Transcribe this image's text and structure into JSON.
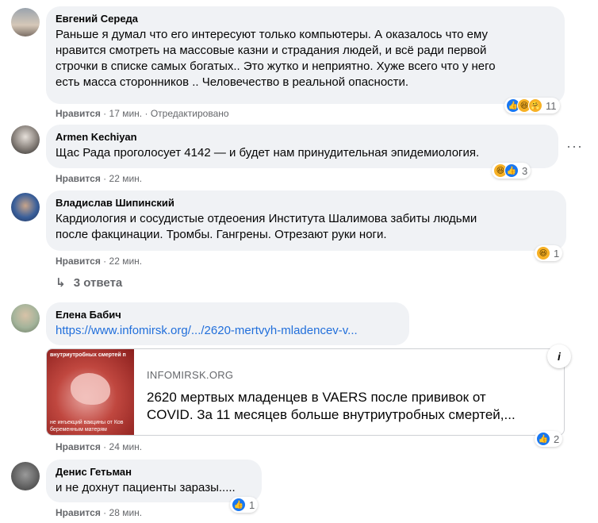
{
  "comments": [
    {
      "author": "Евгений Середа",
      "lines": [
        "Раньше я думал что его интересуют только компьютеры. А оказалось что ему",
        "нравится смотреть на массовые казни и страдания людей, и всё ради первой",
        "строчки в списке самых богатых.. Это жутко и неприятно. Хуже всего что у него",
        "есть масса сторонников .. Человечество в реальной опасности."
      ],
      "like_label": "Нравится",
      "time": "17 мин.",
      "edited": "Отредактировано",
      "reactions": [
        "like-icon",
        "haha-icon",
        "care-icon"
      ],
      "reaction_count": "11"
    },
    {
      "author": "Armen Kechiyan",
      "lines": [
        "Щас Рада проголосует 4142 — и будет нам принудительная эпидемиология."
      ],
      "like_label": "Нравится",
      "time": "22 мин.",
      "reactions": [
        "haha-icon",
        "like-icon"
      ],
      "reaction_count": "3",
      "more": "···"
    },
    {
      "author": "Владислав Шипинский",
      "lines": [
        "Кардиология и сосудистые отдеоения Института Шалимова забиты людьми",
        "после факцинации. Тромбы. Гангрены. Отрезают руки ноги."
      ],
      "like_label": "Нравится",
      "time": "22 мин.",
      "reactions": [
        "haha-icon"
      ],
      "reaction_count": "1",
      "replies": "3 ответа"
    },
    {
      "author": "Елена Бабич",
      "link": "https://www.infomirsk.org/.../2620-mertvyh-mladencev-v...",
      "like_label": "Нравится",
      "time": "24 мин.",
      "reactions": [
        "like-icon"
      ],
      "reaction_count": "2",
      "card": {
        "domain": "INFOMIRSK.ORG",
        "title_lines": [
          "2620 мертвых младенцев в VAERS после прививок от",
          "COVID. За 11 месяцев больше внутриутробных смертей,..."
        ],
        "thumb_top": "внутриутробных смертей п",
        "thumb_bottom_1": "не инъекций вакцины от Ков",
        "thumb_bottom_2": "беременным матерям",
        "info": "i"
      }
    },
    {
      "author": "Денис Гетьман",
      "lines": [
        "и не дохнут пациенты заразы....."
      ],
      "like_label": "Нравится",
      "time": "28 мин.",
      "reactions": [
        "like-icon"
      ],
      "reaction_count": "1"
    }
  ],
  "separator": "·",
  "reply_arrow": "↳"
}
